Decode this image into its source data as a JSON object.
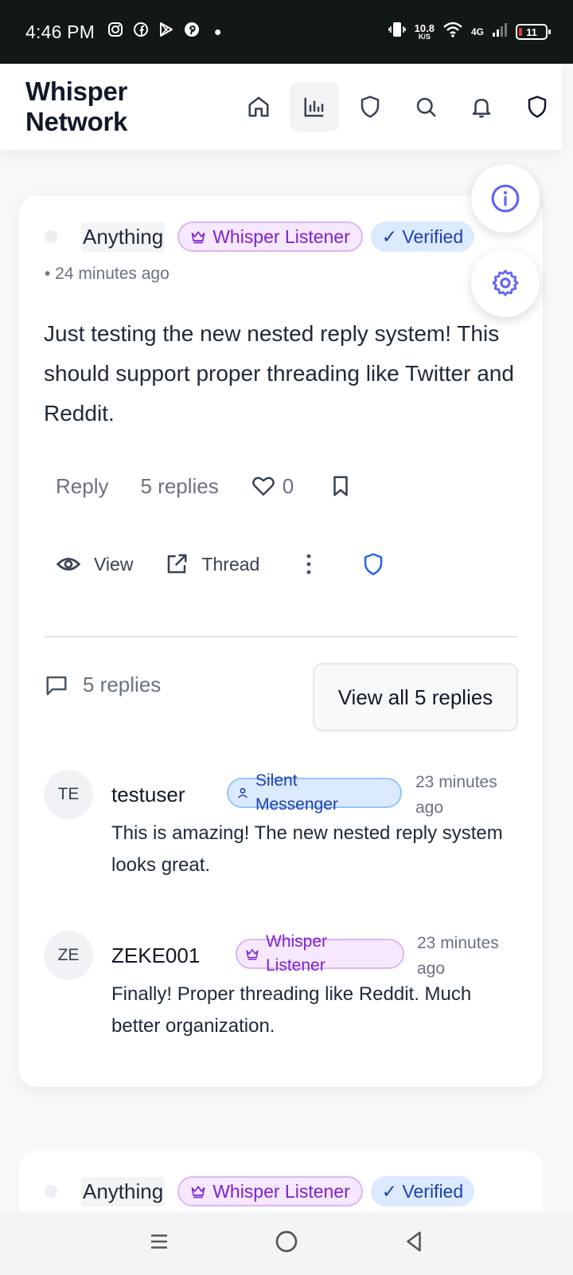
{
  "status_bar": {
    "time": "4:46 PM",
    "speed_value": "10.8",
    "speed_unit": "K/S",
    "network": "4G",
    "battery": "11",
    "app_icons": [
      "instagram-icon",
      "facebook-icon",
      "play-store-icon",
      "pinterest-icon"
    ]
  },
  "header": {
    "brand": "Whisper Network",
    "icons": [
      "home-icon",
      "bar-chart-icon",
      "shield-icon",
      "search-icon",
      "bell-icon",
      "shield-icon"
    ],
    "active_icon": "bar-chart-icon"
  },
  "post": {
    "username": "Anything",
    "badge_role": "Whisper Listener",
    "badge_verified": "✓ Verified",
    "time": "• 24 minutes ago",
    "text": "Just testing the new nested reply system! This should support proper threading like Twitter and Reddit.",
    "actions": {
      "reply": "Reply",
      "replies": "5 replies",
      "likes": "0"
    },
    "secondary_actions": {
      "view": "View",
      "thread": "Thread"
    },
    "replies_count": "5 replies",
    "view_all": "View all 5 replies",
    "replies": [
      {
        "initials": "TE",
        "name": "testuser",
        "badge": "Silent Messenger",
        "time": "23 minutes ago",
        "text": "This is amazing! The new nested reply system looks great."
      },
      {
        "initials": "ZE",
        "name": "ZEKE001",
        "badge": "Whisper Listener",
        "time": "23 minutes ago",
        "text": "Finally! Proper threading like Reddit. Much better organization."
      }
    ]
  },
  "next_post": {
    "username": "Anything",
    "badge_role": "Whisper Listener",
    "badge_verified": "✓ Verified"
  },
  "colors": {
    "accent": "#6366f1",
    "purple_badge": "#7e22ce",
    "blue_badge": "#1e40af",
    "status_bar": "#121814"
  },
  "nav": [
    "menu-icon",
    "home-circle-icon",
    "back-icon"
  ]
}
